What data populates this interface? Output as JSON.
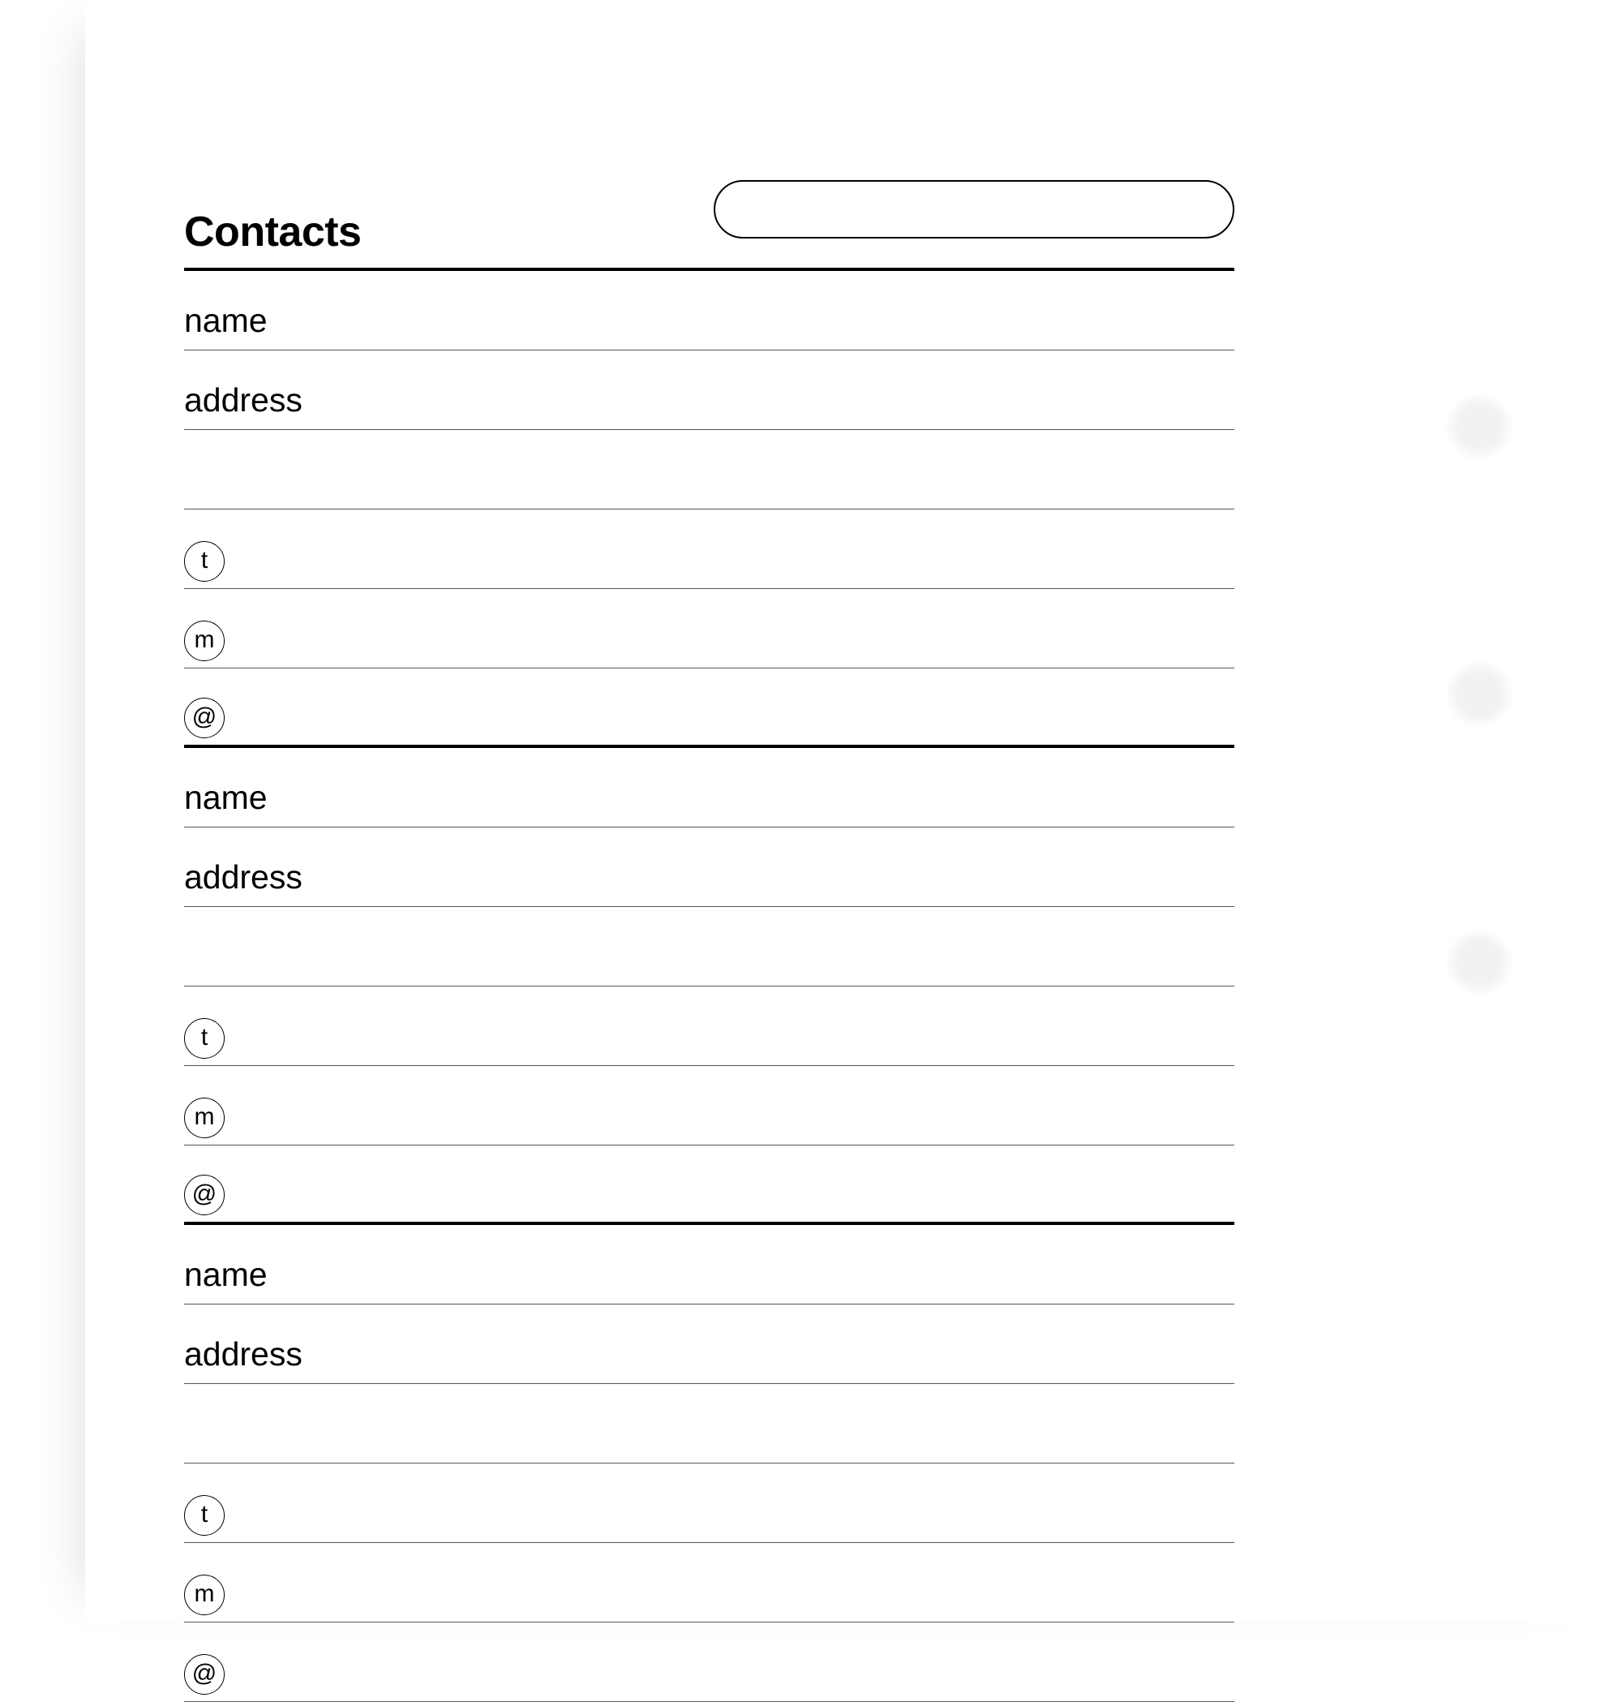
{
  "header": {
    "title": "Contacts"
  },
  "labels": {
    "name": "name",
    "address": "address",
    "telephone_symbol": "t",
    "mobile_symbol": "m",
    "email_symbol": "@"
  }
}
